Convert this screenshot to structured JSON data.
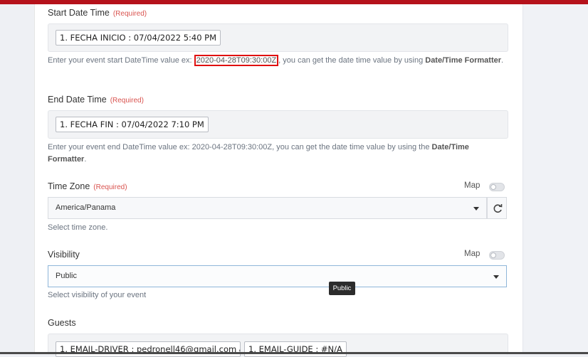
{
  "start": {
    "label": "Start Date Time",
    "required": "(Required)",
    "pill": "1. FECHA INICIO : 07/04/2022 5:40 PM",
    "help_prefix": "Enter your event start DateTime value ex: ",
    "help_example": "2020-04-28T09:30:00Z",
    "help_mid": ", you can get the date time value by using ",
    "help_bold": "Date/Time Formatter",
    "help_end": "."
  },
  "end": {
    "label": "End Date Time",
    "required": "(Required)",
    "pill": "1. FECHA FIN : 07/04/2022 7:10 PM",
    "help_line1_prefix": "Enter your event end DateTime value ex: 2020-04-28T09:30:00Z, you can get the date time value by using the ",
    "help_line1_bold": "Date/Time",
    "help_line2_bold": "Formatter",
    "help_line2_end": "."
  },
  "timezone": {
    "label": "Time Zone",
    "required": "(Required)",
    "map_label": "Map",
    "value": "America/Panama",
    "help": "Select time zone."
  },
  "visibility": {
    "label": "Visibility",
    "map_label": "Map",
    "value": "Public",
    "help": "Select visibility of your event",
    "tooltip": "Public"
  },
  "guests": {
    "label": "Guests",
    "pill1": "1. EMAIL-DRIVER : pedronell46@gmail.com",
    "separator": ",",
    "pill2": "1. EMAIL-GUIDE : #N/A"
  },
  "colors": {
    "topbar": "#b5121b",
    "required": "#d9534f",
    "highlight": "#e01010"
  },
  "icons": [
    "caret-down-icon",
    "refresh-icon"
  ]
}
